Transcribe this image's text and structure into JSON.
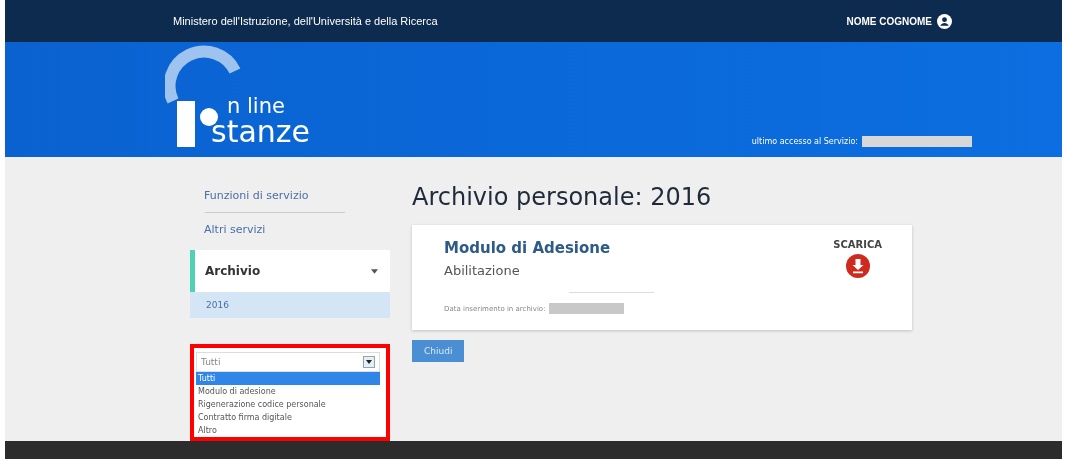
{
  "top_bar": {
    "ministry": "Ministero dell'Istruzione, dell'Università e della Ricerca",
    "user": "NOME COGNOME"
  },
  "header": {
    "logo_top": "n line",
    "logo_bottom": "stanze",
    "last_access_label": "ultimo accesso al Servizio:"
  },
  "sidebar": {
    "items": [
      {
        "label": "Funzioni di servizio",
        "selected": false
      },
      {
        "label": "Altri servizi",
        "selected": false
      },
      {
        "label": "Archivio",
        "selected": true,
        "children": [
          {
            "label": "2016",
            "selected": true
          }
        ]
      }
    ]
  },
  "filter": {
    "value": "Tutti",
    "options": [
      {
        "label": "Tutti",
        "selected": true
      },
      {
        "label": "Modulo di adesione",
        "selected": false
      },
      {
        "label": "Rigenerazione codice personale",
        "selected": false
      },
      {
        "label": "Contratto firma digitale",
        "selected": false
      },
      {
        "label": "Altro",
        "selected": false
      }
    ]
  },
  "main": {
    "title": "Archivio personale: 2016",
    "card": {
      "title": "Modulo di Adesione",
      "subtitle": "Abilitazione",
      "date_label": "Data inserimento in archivio:",
      "action": "SCARICA"
    },
    "close_button": "Chiudi"
  }
}
